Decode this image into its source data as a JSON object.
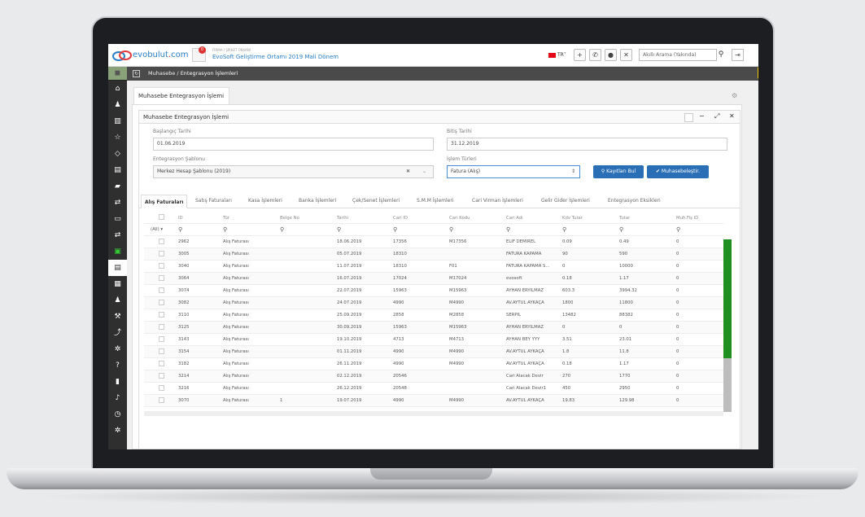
{
  "topbar": {
    "logo_text_blue": "evobulut",
    "logo_text_dot": ".",
    "logo_text_com": "com",
    "notification_count": "0",
    "company_label": "FİRMA / ŞİRKET ÜNVANI",
    "company_name": "EvoSoft Geliştirme Ortamı 2019 Mali Dönem",
    "language": "TR",
    "search_placeholder": "Akıllı Arama (Yakında)",
    "icons": [
      "plus-icon",
      "phone-icon",
      "microphone-icon",
      "expand-icon",
      "search-icon",
      "exit-icon"
    ]
  },
  "breadcrumb": {
    "parent": "Muhasebe /",
    "current": "Entegrasyon İşlemleri"
  },
  "page_tab": "Muhasebe Entegrasyon İşlemi",
  "panel": {
    "title": "Muhasebe Entegrasyon İşlemi",
    "start_date_label": "Başlangıç Tarihi",
    "start_date": "01.06.2019",
    "end_date_label": "Bitiş Tarihi",
    "end_date": "31.12.2019",
    "template_label": "Entegrasyon Şablonu",
    "template_value": "Merkez Hesap Şablonu (2019)",
    "process_label": "İşlem Türleri",
    "process_value": "Fatura (Alış)",
    "find_button": "Kayıtları Bul",
    "post_button": "Muhasebeleştir."
  },
  "subtabs": [
    "Alış Faturaları",
    "Satış Faturaları",
    "Kasa İşlemleri",
    "Banka İşlemleri",
    "Çek/Senet İşlemleri",
    "S.M.M İşlemleri",
    "Cari Virman İşlemleri",
    "Gelir Gider İşlemleri",
    "Entegrasyon Eksikleri"
  ],
  "grid": {
    "columns": [
      "ID",
      "Tür",
      "Belge No",
      "Tarihi",
      "Cari ID",
      "Cari Kodu",
      "Cari Adı",
      "Kdv Tutar",
      "Tutar",
      "Muh.Fiş ID"
    ],
    "filter_all": "(All)",
    "rows": [
      [
        "2962",
        "Alış Faturası",
        "",
        "18.06.2019",
        "17356",
        "M17356",
        "ELİF DEMİREL",
        "0.09",
        "0.49",
        "0"
      ],
      [
        "3005",
        "Alış Faturası",
        "",
        "05.07.2019",
        "18310",
        "",
        "FATURA KAPAMA",
        "90",
        "590",
        "0"
      ],
      [
        "3040",
        "Alış Faturası",
        "",
        "11.07.2019",
        "18310",
        "F01",
        "FATURA KAPAMA S...",
        "0",
        "10000",
        "0"
      ],
      [
        "3064",
        "Alış Faturası",
        "",
        "16.07.2019",
        "17024",
        "M17024",
        "evosoft",
        "0.18",
        "1.17",
        "0"
      ],
      [
        "3074",
        "Alış Faturası",
        "",
        "22.07.2019",
        "15963",
        "M15963",
        "AYHAN ERYILMAZ",
        "603.3",
        "3994.32",
        "0"
      ],
      [
        "3082",
        "Alış Faturası",
        "",
        "24.07.2019",
        "4990",
        "M4990",
        "AV.AYTÜL AYKAÇA",
        "1800",
        "11800",
        "0"
      ],
      [
        "3110",
        "Alış Faturası",
        "",
        "25.09.2019",
        "2858",
        "M2858",
        "SERPİL",
        "13482",
        "88382",
        "0"
      ],
      [
        "3125",
        "Alış Faturası",
        "",
        "30.09.2019",
        "15963",
        "M15963",
        "AYHAN ERYILMAZ",
        "0",
        "0",
        "0"
      ],
      [
        "3143",
        "Alış Faturası",
        "",
        "19.10.2019",
        "4713",
        "M4713",
        "AYHAN BEY YYY",
        "3.51",
        "23.01",
        "0"
      ],
      [
        "3154",
        "Alış Faturası",
        "",
        "01.11.2019",
        "4990",
        "M4990",
        "AV.AYTÜL AYKAÇA",
        "1.8",
        "11.8",
        "0"
      ],
      [
        "3182",
        "Alış Faturası",
        "",
        "26.11.2019",
        "4990",
        "M4990",
        "AV.AYTÜL AYKAÇA",
        "0.18",
        "1.17",
        "0"
      ],
      [
        "3214",
        "Alış Faturası",
        "",
        "02.12.2019",
        "20546",
        "",
        "Cari Alacak Devir",
        "270",
        "1770",
        "0"
      ],
      [
        "3216",
        "Alış Faturası",
        "",
        "26.12.2019",
        "20548",
        "",
        "Cari Alacak Devir1",
        "450",
        "2950",
        "0"
      ],
      [
        "3070",
        "Alış Faturası",
        "1",
        "19.07.2019",
        "4990",
        "M4990",
        "AV.AYTÜL AYKAÇA",
        "19.83",
        "129.98",
        "0"
      ]
    ]
  }
}
